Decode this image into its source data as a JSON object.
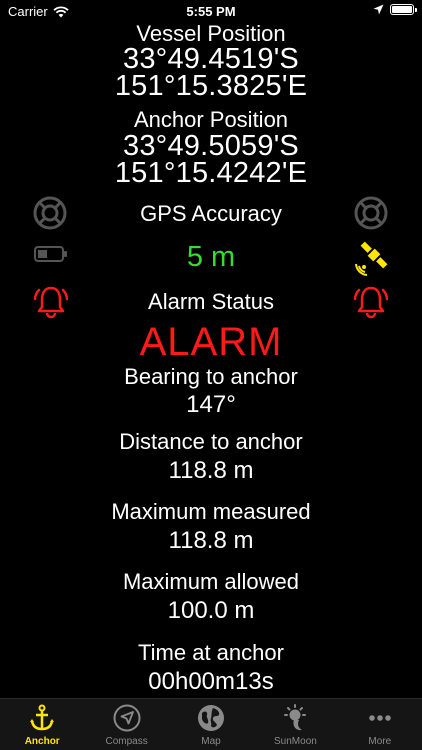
{
  "status_bar": {
    "carrier": "Carrier",
    "time": "5:55 PM",
    "icons": [
      "wifi-icon",
      "location-arrow-icon",
      "battery-icon"
    ]
  },
  "vessel": {
    "label": "Vessel Position",
    "lat": "33°49.4519'S",
    "lon": "151°15.3825'E"
  },
  "anchor": {
    "label": "Anchor Position",
    "lat": "33°49.5059'S",
    "lon": "151°15.4242'E"
  },
  "gps": {
    "label": "GPS Accuracy",
    "value": "5 m",
    "value_color": "#33dd33"
  },
  "alarm": {
    "label": "Alarm Status",
    "value": "ALARM",
    "color": "#ff1a1a"
  },
  "bearing": {
    "label": "Bearing to anchor",
    "value": "147°"
  },
  "distance": {
    "label": "Distance to anchor",
    "value": "118.8 m"
  },
  "max_measured": {
    "label": "Maximum measured",
    "value": "118.8 m"
  },
  "max_allowed": {
    "label": "Maximum allowed",
    "value": "100.0 m"
  },
  "time_at_anchor": {
    "label": "Time at anchor",
    "value": "00h00m13s"
  },
  "side_icons": {
    "left": [
      "lifebuoy-icon",
      "battery-low-icon",
      "alarm-bell-icon"
    ],
    "right": [
      "lifebuoy-icon",
      "satellite-icon",
      "alarm-bell-icon"
    ]
  },
  "tabs": [
    {
      "label": "Anchor",
      "icon": "anchor-icon",
      "active": true
    },
    {
      "label": "Compass",
      "icon": "compass-icon",
      "active": false
    },
    {
      "label": "Map",
      "icon": "globe-icon",
      "active": false
    },
    {
      "label": "SunMoon",
      "icon": "sun-moon-icon",
      "active": false
    },
    {
      "label": "More",
      "icon": "more-icon",
      "active": false
    }
  ],
  "colors": {
    "background": "#000000",
    "accent": "#ffe600",
    "alarm": "#ff1a1a",
    "good": "#33dd33",
    "icon_gray": "#555555"
  }
}
